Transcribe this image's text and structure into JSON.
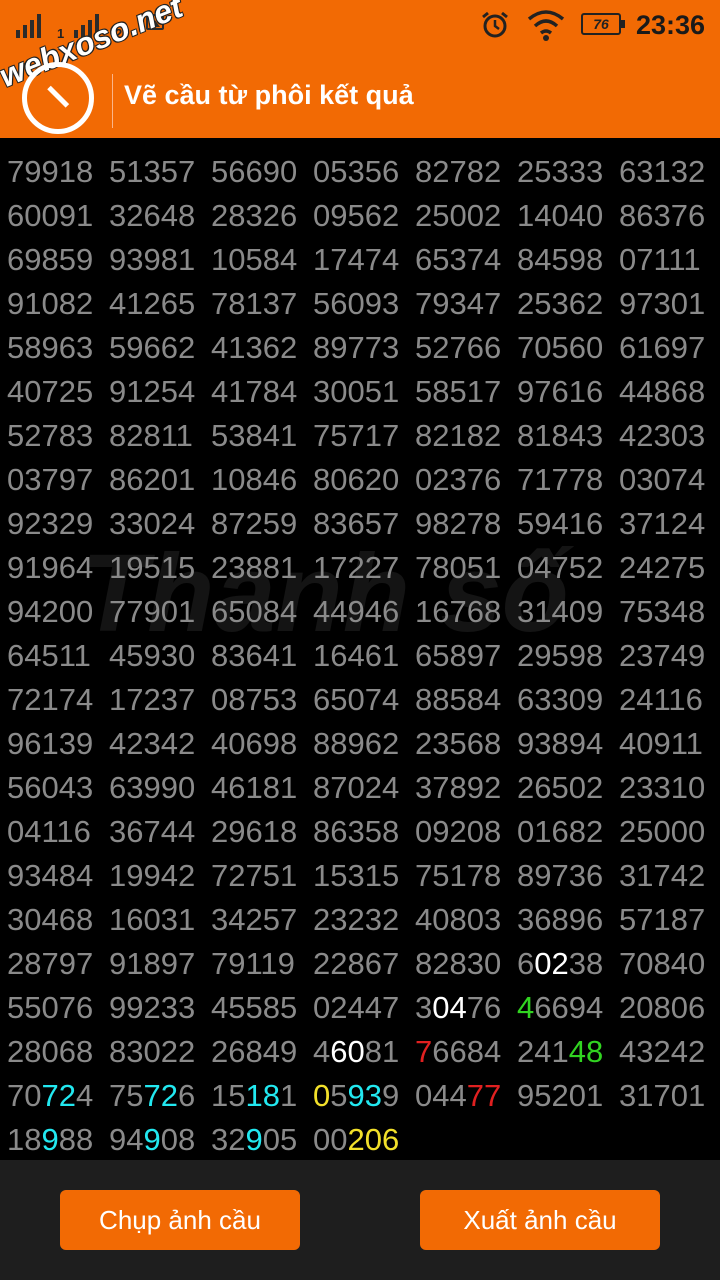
{
  "status_bar": {
    "sim1": "1",
    "sim2": "2",
    "watermark": "webxoso.net",
    "battery": "76",
    "time": "23:36"
  },
  "header": {
    "title": "Vẽ cầu từ phôi kết quả",
    "icon": "clock-icon"
  },
  "background_watermark": "Thanh số",
  "grid": {
    "rows": [
      [
        [
          [
            "79918",
            ""
          ]
        ],
        [
          [
            "51357",
            ""
          ]
        ],
        [
          [
            "56690",
            ""
          ]
        ],
        [
          [
            "05356",
            ""
          ]
        ],
        [
          [
            "82782",
            ""
          ]
        ],
        [
          [
            "25333",
            ""
          ]
        ],
        [
          [
            "63132",
            ""
          ]
        ]
      ],
      [
        [
          [
            "60091",
            ""
          ]
        ],
        [
          [
            "32648",
            ""
          ]
        ],
        [
          [
            "28326",
            ""
          ]
        ],
        [
          [
            "09562",
            ""
          ]
        ],
        [
          [
            "25002",
            ""
          ]
        ],
        [
          [
            "14040",
            ""
          ]
        ],
        [
          [
            "86376",
            ""
          ]
        ]
      ],
      [
        [
          [
            "69859",
            ""
          ]
        ],
        [
          [
            "93981",
            ""
          ]
        ],
        [
          [
            "10584",
            ""
          ]
        ],
        [
          [
            "17474",
            ""
          ]
        ],
        [
          [
            "65374",
            ""
          ]
        ],
        [
          [
            "84598",
            ""
          ]
        ],
        [
          [
            "07111",
            ""
          ]
        ]
      ],
      [
        [
          [
            "91082",
            ""
          ]
        ],
        [
          [
            "41265",
            ""
          ]
        ],
        [
          [
            "78137",
            ""
          ]
        ],
        [
          [
            "56093",
            ""
          ]
        ],
        [
          [
            "79347",
            ""
          ]
        ],
        [
          [
            "25362",
            ""
          ]
        ],
        [
          [
            "97301",
            ""
          ]
        ]
      ],
      [
        [
          [
            "58963",
            ""
          ]
        ],
        [
          [
            "59662",
            ""
          ]
        ],
        [
          [
            "41362",
            ""
          ]
        ],
        [
          [
            "89773",
            ""
          ]
        ],
        [
          [
            "52766",
            ""
          ]
        ],
        [
          [
            "70560",
            ""
          ]
        ],
        [
          [
            "61697",
            ""
          ]
        ]
      ],
      [
        [
          [
            "40725",
            ""
          ]
        ],
        [
          [
            "91254",
            ""
          ]
        ],
        [
          [
            "41784",
            ""
          ]
        ],
        [
          [
            "30051",
            ""
          ]
        ],
        [
          [
            "58517",
            ""
          ]
        ],
        [
          [
            "97616",
            ""
          ]
        ],
        [
          [
            "44868",
            ""
          ]
        ]
      ],
      [
        [
          [
            "52783",
            ""
          ]
        ],
        [
          [
            "82811",
            ""
          ]
        ],
        [
          [
            "53841",
            ""
          ]
        ],
        [
          [
            "75717",
            ""
          ]
        ],
        [
          [
            "82182",
            ""
          ]
        ],
        [
          [
            "81843",
            ""
          ]
        ],
        [
          [
            "42303",
            ""
          ]
        ]
      ],
      [
        [
          [
            "03797",
            ""
          ]
        ],
        [
          [
            "86201",
            ""
          ]
        ],
        [
          [
            "10846",
            ""
          ]
        ],
        [
          [
            "80620",
            ""
          ]
        ],
        [
          [
            "02376",
            ""
          ]
        ],
        [
          [
            "71778",
            ""
          ]
        ],
        [
          [
            "03074",
            ""
          ]
        ]
      ],
      [
        [
          [
            "92329",
            ""
          ]
        ],
        [
          [
            "33024",
            ""
          ]
        ],
        [
          [
            "87259",
            ""
          ]
        ],
        [
          [
            "83657",
            ""
          ]
        ],
        [
          [
            "98278",
            ""
          ]
        ],
        [
          [
            "59416",
            ""
          ]
        ],
        [
          [
            "37124",
            ""
          ]
        ]
      ],
      [
        [
          [
            "91964",
            ""
          ]
        ],
        [
          [
            "19515",
            ""
          ]
        ],
        [
          [
            "23881",
            ""
          ]
        ],
        [
          [
            "17227",
            ""
          ]
        ],
        [
          [
            "78051",
            ""
          ]
        ],
        [
          [
            "04752",
            ""
          ]
        ],
        [
          [
            "24275",
            ""
          ]
        ]
      ],
      [
        [
          [
            "94200",
            ""
          ]
        ],
        [
          [
            "77901",
            ""
          ]
        ],
        [
          [
            "65084",
            ""
          ]
        ],
        [
          [
            "44946",
            ""
          ]
        ],
        [
          [
            "16768",
            ""
          ]
        ],
        [
          [
            "31409",
            ""
          ]
        ],
        [
          [
            "75348",
            ""
          ]
        ]
      ],
      [
        [
          [
            "64511",
            ""
          ]
        ],
        [
          [
            "45930",
            ""
          ]
        ],
        [
          [
            "83641",
            ""
          ]
        ],
        [
          [
            "16461",
            ""
          ]
        ],
        [
          [
            "65897",
            ""
          ]
        ],
        [
          [
            "29598",
            ""
          ]
        ],
        [
          [
            "23749",
            ""
          ]
        ]
      ],
      [
        [
          [
            "72174",
            ""
          ]
        ],
        [
          [
            "17237",
            ""
          ]
        ],
        [
          [
            "08753",
            ""
          ]
        ],
        [
          [
            "65074",
            ""
          ]
        ],
        [
          [
            "88584",
            ""
          ]
        ],
        [
          [
            "63309",
            ""
          ]
        ],
        [
          [
            "24116",
            ""
          ]
        ]
      ],
      [
        [
          [
            "96139",
            ""
          ]
        ],
        [
          [
            "42342",
            ""
          ]
        ],
        [
          [
            "40698",
            ""
          ]
        ],
        [
          [
            "88962",
            ""
          ]
        ],
        [
          [
            "23568",
            ""
          ]
        ],
        [
          [
            "93894",
            ""
          ]
        ],
        [
          [
            "40911",
            ""
          ]
        ]
      ],
      [
        [
          [
            "56043",
            ""
          ]
        ],
        [
          [
            "63990",
            ""
          ]
        ],
        [
          [
            "46181",
            ""
          ]
        ],
        [
          [
            "87024",
            ""
          ]
        ],
        [
          [
            "37892",
            ""
          ]
        ],
        [
          [
            "26502",
            ""
          ]
        ],
        [
          [
            "23310",
            ""
          ]
        ]
      ],
      [
        [
          [
            "04116",
            ""
          ]
        ],
        [
          [
            "36744",
            ""
          ]
        ],
        [
          [
            "29618",
            ""
          ]
        ],
        [
          [
            "86358",
            ""
          ]
        ],
        [
          [
            "09208",
            ""
          ]
        ],
        [
          [
            "01682",
            ""
          ]
        ],
        [
          [
            "25000",
            ""
          ]
        ]
      ],
      [
        [
          [
            "93484",
            ""
          ]
        ],
        [
          [
            "19942",
            ""
          ]
        ],
        [
          [
            "72751",
            ""
          ]
        ],
        [
          [
            "15315",
            ""
          ]
        ],
        [
          [
            "75178",
            ""
          ]
        ],
        [
          [
            "89736",
            ""
          ]
        ],
        [
          [
            "31742",
            ""
          ]
        ]
      ],
      [
        [
          [
            "30468",
            ""
          ]
        ],
        [
          [
            "16031",
            ""
          ]
        ],
        [
          [
            "34257",
            ""
          ]
        ],
        [
          [
            "23232",
            ""
          ]
        ],
        [
          [
            "40803",
            ""
          ]
        ],
        [
          [
            "36896",
            ""
          ]
        ],
        [
          [
            "57187",
            ""
          ]
        ]
      ],
      [
        [
          [
            "28797",
            ""
          ]
        ],
        [
          [
            "91897",
            ""
          ]
        ],
        [
          [
            "79119",
            ""
          ]
        ],
        [
          [
            "22867",
            ""
          ]
        ],
        [
          [
            "82830",
            ""
          ]
        ],
        [
          [
            "6",
            ""
          ],
          [
            "02",
            "w"
          ],
          [
            "38",
            ""
          ]
        ],
        [
          [
            "70840",
            ""
          ]
        ]
      ],
      [
        [
          [
            "55076",
            ""
          ]
        ],
        [
          [
            "99233",
            ""
          ]
        ],
        [
          [
            "45585",
            ""
          ]
        ],
        [
          [
            "02447",
            ""
          ]
        ],
        [
          [
            "3",
            ""
          ],
          [
            "04",
            "w"
          ],
          [
            "76",
            ""
          ]
        ],
        [
          [
            "4",
            "g"
          ],
          [
            "6694",
            ""
          ]
        ],
        [
          [
            "20806",
            ""
          ]
        ]
      ],
      [
        [
          [
            "28068",
            ""
          ]
        ],
        [
          [
            "83022",
            ""
          ]
        ],
        [
          [
            "26849",
            ""
          ]
        ],
        [
          [
            "4",
            ""
          ],
          [
            "60",
            "w"
          ],
          [
            "81",
            ""
          ]
        ],
        [
          [
            "7",
            "r"
          ],
          [
            "6684",
            ""
          ]
        ],
        [
          [
            "241",
            ""
          ],
          [
            "48",
            "g"
          ]
        ],
        [
          [
            "43242",
            ""
          ]
        ]
      ],
      [
        [
          [
            "70",
            ""
          ],
          [
            "72",
            "c"
          ],
          [
            "4",
            ""
          ]
        ],
        [
          [
            "75",
            ""
          ],
          [
            "72",
            "c"
          ],
          [
            "6",
            ""
          ]
        ],
        [
          [
            "15",
            ""
          ],
          [
            "18",
            "c"
          ],
          [
            "1",
            ""
          ]
        ],
        [
          [
            "0",
            "y"
          ],
          [
            "5",
            ""
          ],
          [
            "93",
            "c"
          ],
          [
            "9",
            ""
          ]
        ],
        [
          [
            "044",
            ""
          ],
          [
            "77",
            "r"
          ]
        ],
        [
          [
            "95201",
            ""
          ]
        ],
        [
          [
            "31701",
            ""
          ]
        ]
      ],
      [
        [
          [
            "18",
            ""
          ],
          [
            "9",
            "c"
          ],
          [
            "88",
            ""
          ]
        ],
        [
          [
            "94",
            ""
          ],
          [
            "9",
            "c"
          ],
          [
            "08",
            ""
          ]
        ],
        [
          [
            "32",
            ""
          ],
          [
            "9",
            "c"
          ],
          [
            "05",
            ""
          ]
        ],
        [
          [
            "00",
            ""
          ],
          [
            "206",
            "y"
          ]
        ]
      ]
    ]
  },
  "buttons": {
    "capture": "Chụp ảnh cầu",
    "export": "Xuất ảnh cầu"
  },
  "colors": {
    "header_bg": "#f26a04",
    "cell_text": "#8a8a8a",
    "highlight_white": "#ffffff",
    "highlight_green": "#31d421",
    "highlight_red": "#e02020",
    "highlight_cyan": "#22e8f0",
    "highlight_yellow": "#f2e02a"
  }
}
